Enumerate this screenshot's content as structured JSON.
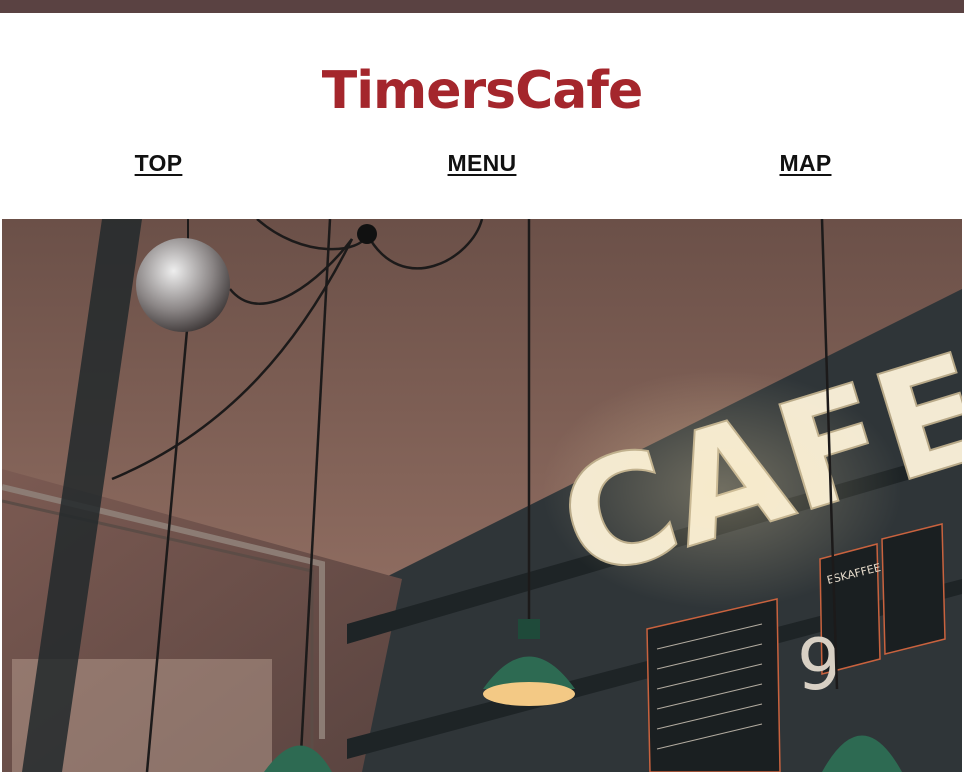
{
  "site": {
    "title": "TimersCafe"
  },
  "nav": {
    "items": [
      {
        "label": "TOP"
      },
      {
        "label": "MENU"
      },
      {
        "label": "MAP"
      }
    ]
  },
  "hero": {
    "sign_text": "CAFE",
    "menu_board_text": "ESKAFFEE"
  },
  "colors": {
    "topbar": "#5a4242",
    "brand": "#a4262c",
    "nav_text": "#111111"
  }
}
